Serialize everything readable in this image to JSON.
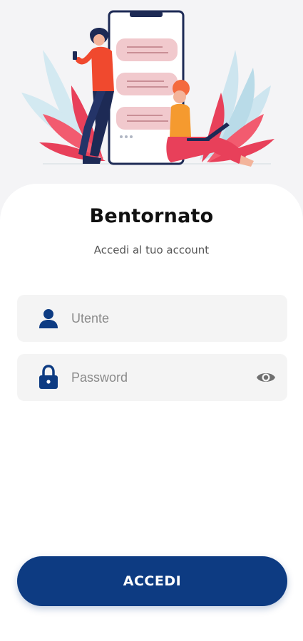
{
  "login": {
    "title": "Bentornato",
    "subtitle": "Accedi al tuo account",
    "username_placeholder": "Utente",
    "password_placeholder": "Password",
    "username_icon": "user-icon",
    "password_icon": "lock-icon",
    "visibility_icon": "eye-icon",
    "submit_label": "ACCEDI"
  },
  "colors": {
    "primary": "#0d3b82",
    "field_bg": "#f4f4f4",
    "accent_red": "#e8405a",
    "accent_blue": "#b9dbe8"
  }
}
